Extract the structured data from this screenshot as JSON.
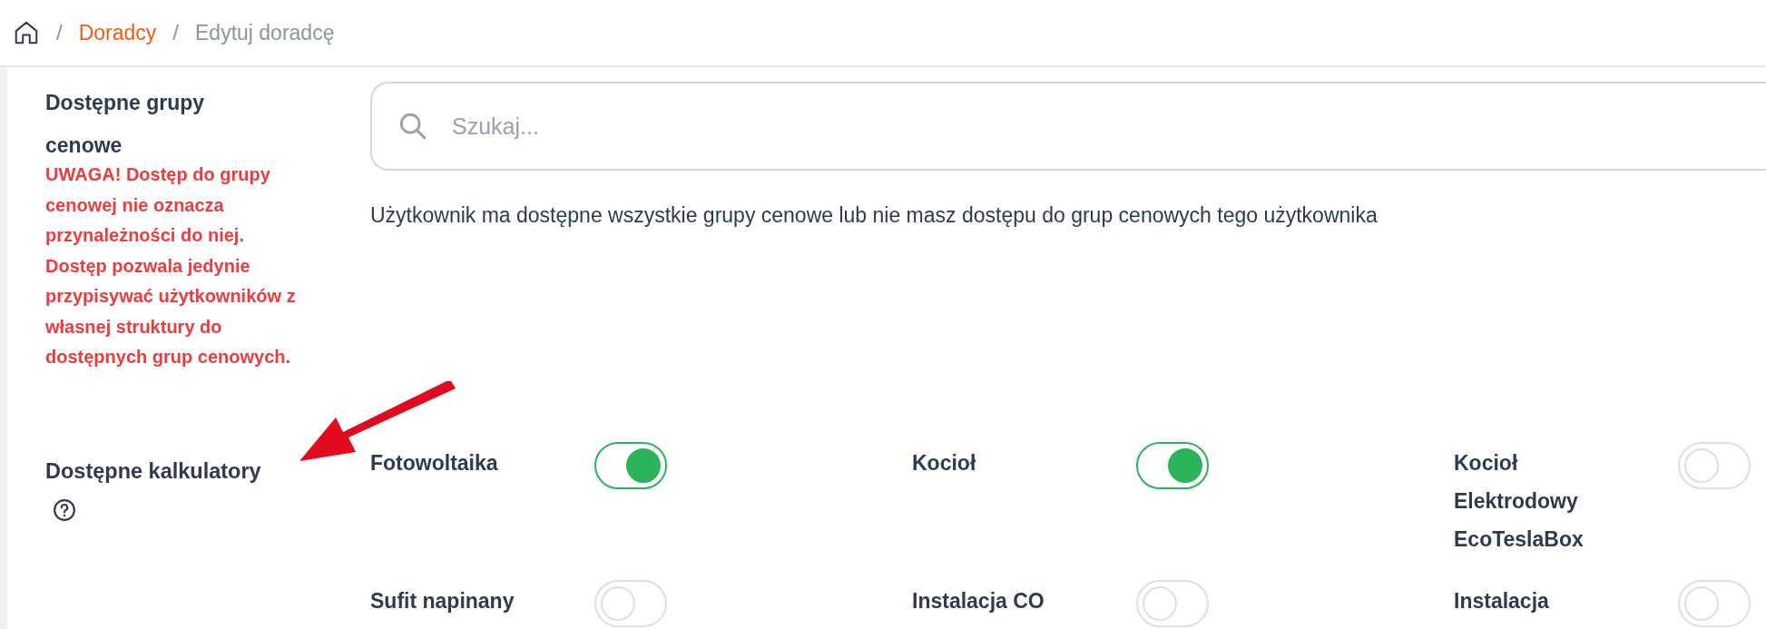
{
  "breadcrumb": [
    {
      "separator": "/",
      "label": "Doradcy",
      "kind": "link"
    },
    {
      "separator": "/",
      "label": "Edytuj doradcę",
      "kind": "current"
    }
  ],
  "price_groups": {
    "label": "Dostępne grupy cenowe",
    "warning": "UWAGA! Dostęp do grupy cenowej nie oznacza przynależności do niej. Dostęp pozwala jedynie przypisywać użytkowników z własnej struktury do dostępnych grup cenowych.",
    "search": {
      "placeholder": "Szukaj..."
    },
    "message": "Użytkownik ma dostępne wszystkie grupy cenowe lub nie masz dostępu do grup cenowych tego użytkownika"
  },
  "calculators": {
    "label": "Dostępne kalkulatory",
    "items": [
      {
        "name": "Fotowoltaika",
        "on": true
      },
      {
        "name": "Kocioł",
        "on": true
      },
      {
        "name": "Kocioł Elektrodowy EcoTeslaBox",
        "on": false
      },
      {
        "name": "Sufit napinany",
        "on": false
      },
      {
        "name": "Instalacja CO",
        "on": false
      },
      {
        "name": "Instalacja",
        "on": false
      }
    ]
  }
}
